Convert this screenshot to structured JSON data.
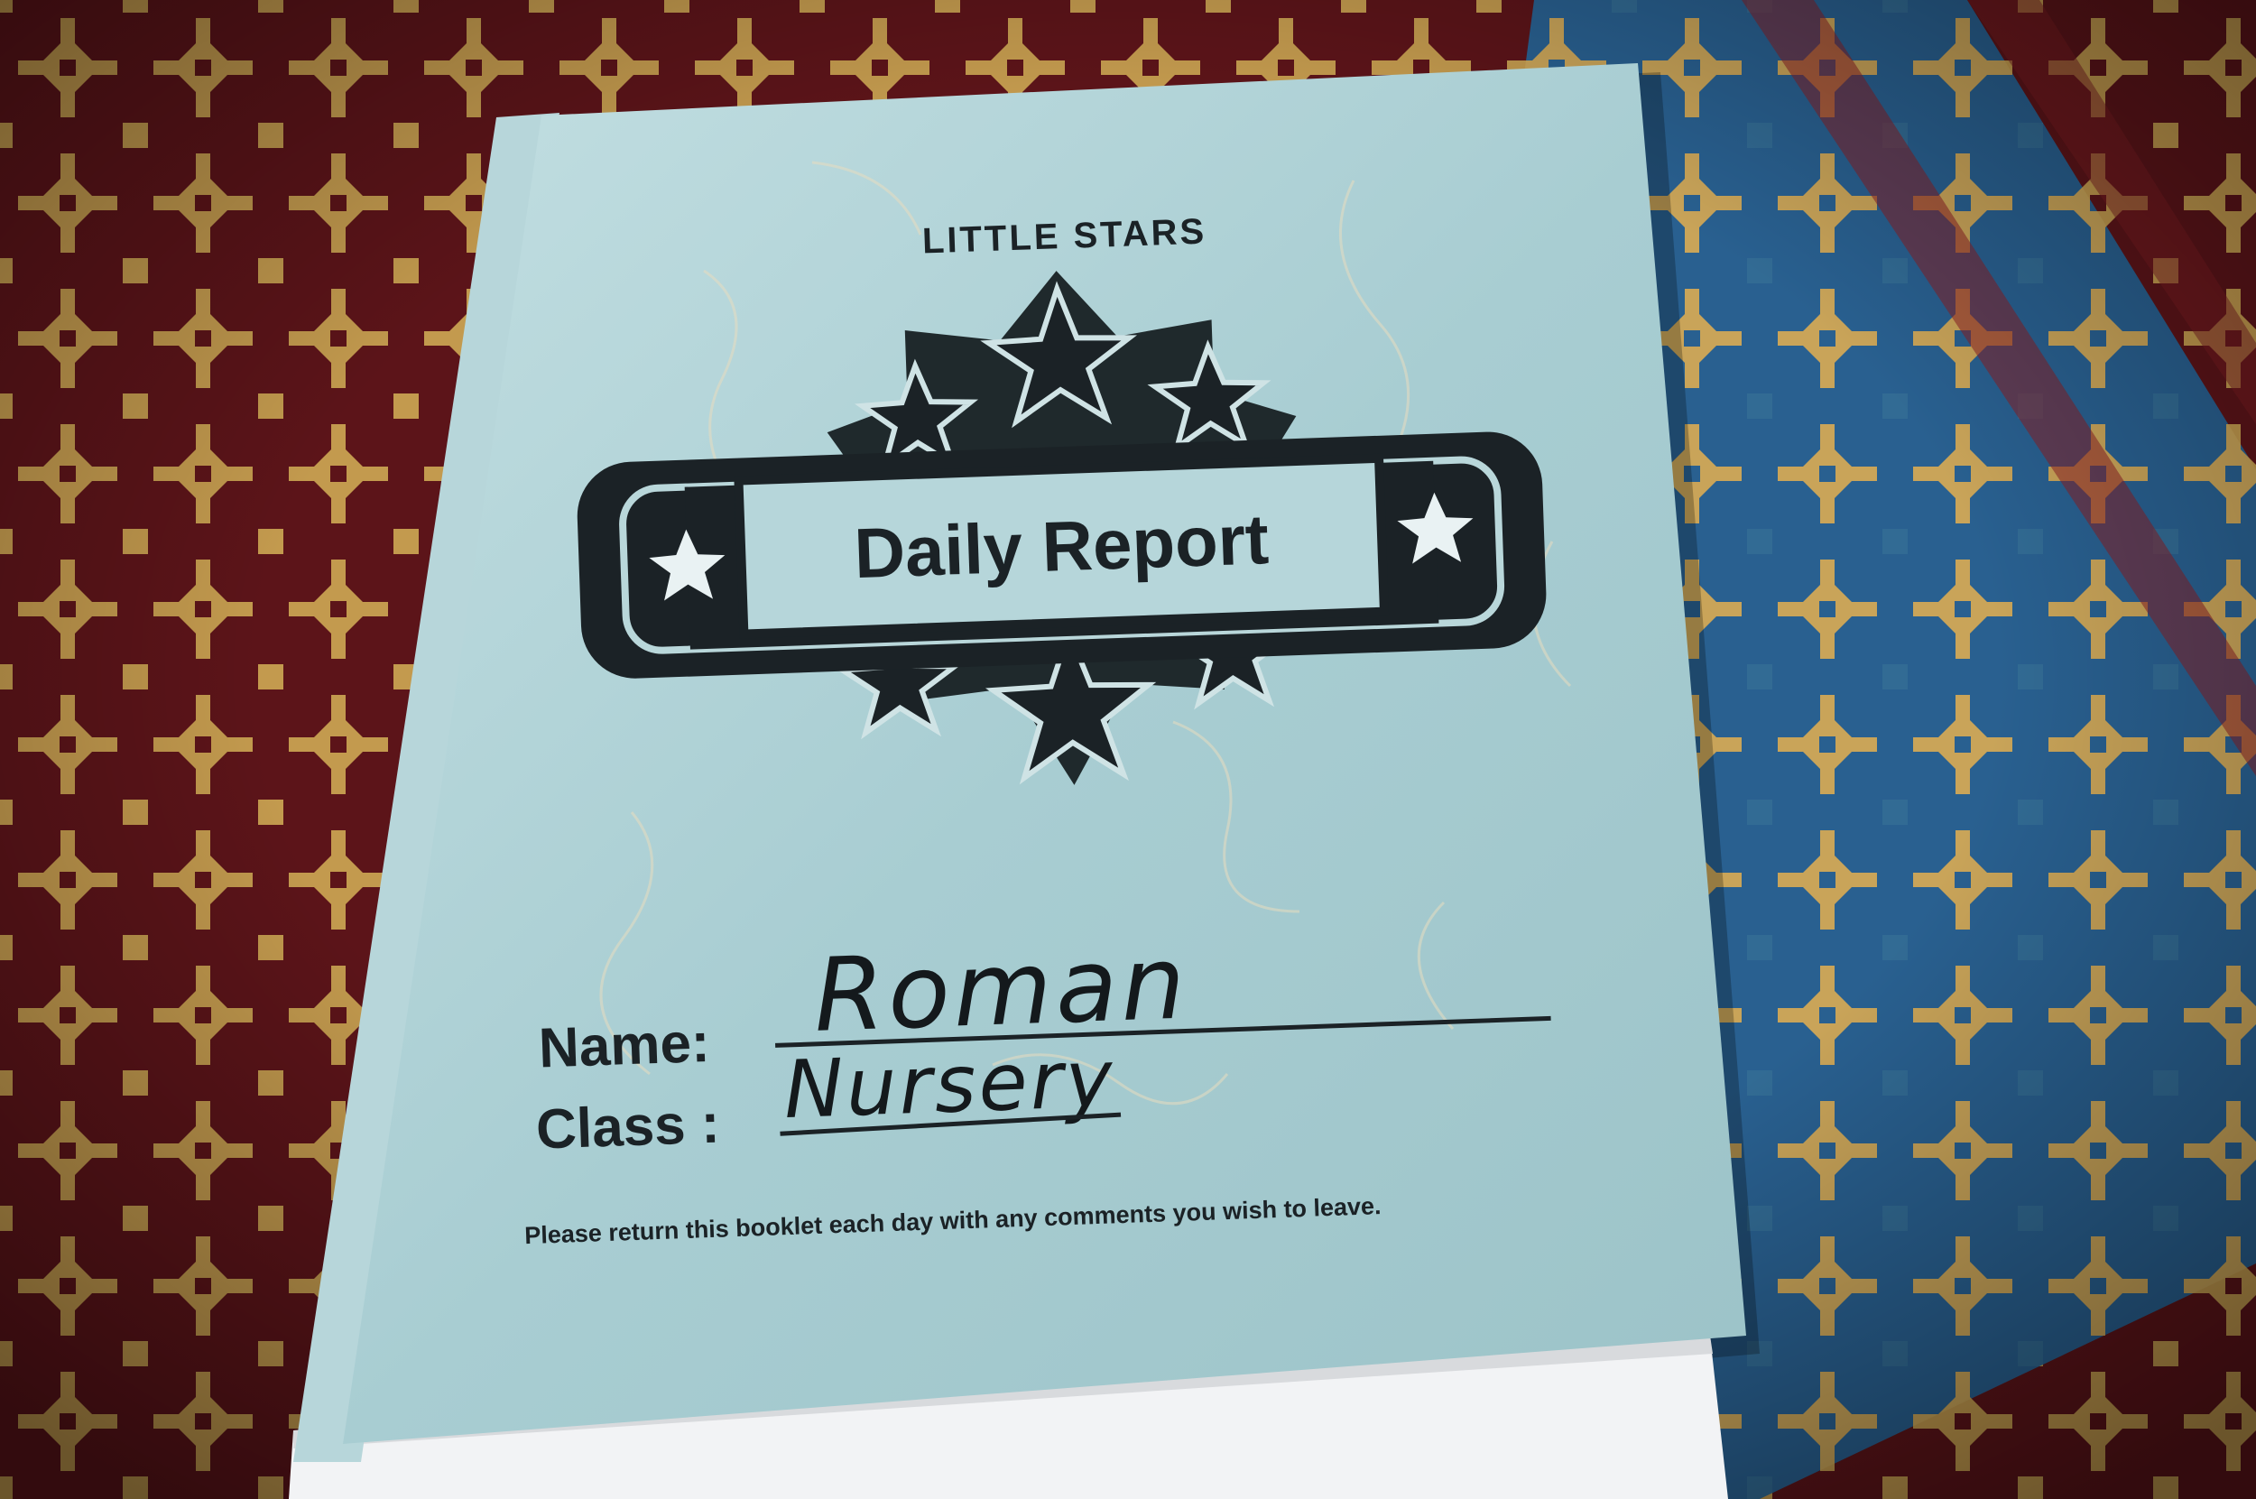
{
  "booklet": {
    "brand": "LITTLE STARS",
    "badge_title": "Daily Report",
    "name_label": "Name:",
    "name_value": "Roman",
    "class_label": "Class :",
    "class_value": "Nursery",
    "footer_note": "Please return this booklet each day with any comments you wish to leave."
  },
  "colors": {
    "cover": "#a9cdd0",
    "cloth_red": "#6b1a1d",
    "cloth_gold": "#c39a4e",
    "cloth_blue": "#2a6f9a",
    "ink": "#1b2226"
  }
}
